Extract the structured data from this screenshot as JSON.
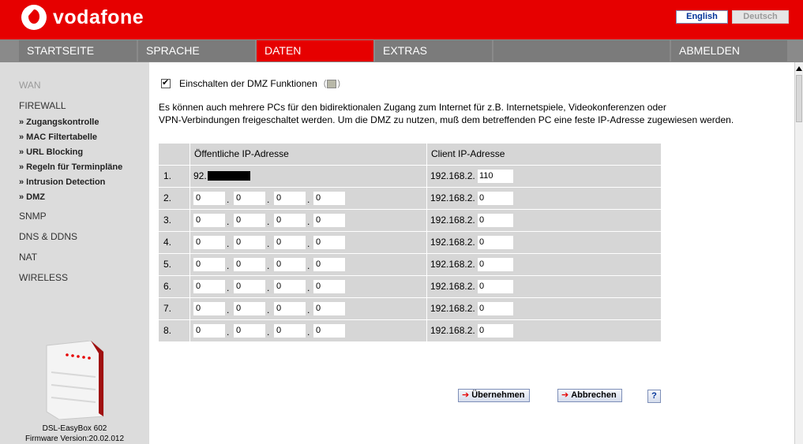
{
  "header": {
    "brand": "vodafone",
    "lang_english": "English",
    "lang_deutsch": "Deutsch"
  },
  "nav": [
    {
      "label": "STARTSEITE"
    },
    {
      "label": "SPRACHE"
    },
    {
      "label": "DATEN"
    },
    {
      "label": "EXTRAS"
    },
    {
      "label": ""
    },
    {
      "label": "ABMELDEN"
    }
  ],
  "sidebar": {
    "wan": "WAN",
    "firewall": "FIREWALL",
    "sub": [
      "» Zugangskontrolle",
      "» MAC Filtertabelle",
      "» URL Blocking",
      "» Regeln für Terminpläne",
      "» Intrusion Detection",
      "» DMZ"
    ],
    "snmp": "SNMP",
    "dns": "DNS & DDNS",
    "nat": "NAT",
    "wireless": "WIRELESS",
    "device_name": "DSL-EasyBox 602",
    "firmware": "Firmware Version:20.02.012"
  },
  "main": {
    "dmz_label": "Einschalten der DMZ Funktionen",
    "description_line1": "Es können auch mehrere PCs für den bidirektionalen Zugang zum Internet für z.B. Internetspiele, Videokonferenzen oder",
    "description_line2": "VPN-Verbindungen freigeschaltet werden. Um die DMZ zu nutzen, muß dem betreffenden PC eine feste IP-Adresse zugewiesen werden.",
    "col_public": "Öffentliche IP-Adresse",
    "col_client": "Client IP-Adresse",
    "first_public_prefix": "92.",
    "client_prefix": "192.168.2.",
    "rows": [
      {
        "num": "1.",
        "o1": "",
        "o2": "",
        "o3": "",
        "o4": "",
        "host": "110"
      },
      {
        "num": "2.",
        "o1": "0",
        "o2": "0",
        "o3": "0",
        "o4": "0",
        "host": "0"
      },
      {
        "num": "3.",
        "o1": "0",
        "o2": "0",
        "o3": "0",
        "o4": "0",
        "host": "0"
      },
      {
        "num": "4.",
        "o1": "0",
        "o2": "0",
        "o3": "0",
        "o4": "0",
        "host": "0"
      },
      {
        "num": "5.",
        "o1": "0",
        "o2": "0",
        "o3": "0",
        "o4": "0",
        "host": "0"
      },
      {
        "num": "6.",
        "o1": "0",
        "o2": "0",
        "o3": "0",
        "o4": "0",
        "host": "0"
      },
      {
        "num": "7.",
        "o1": "0",
        "o2": "0",
        "o3": "0",
        "o4": "0",
        "host": "0"
      },
      {
        "num": "8.",
        "o1": "0",
        "o2": "0",
        "o3": "0",
        "o4": "0",
        "host": "0"
      }
    ],
    "apply": "Übernehmen",
    "cancel": "Abbrechen",
    "help": "?"
  },
  "colors": {
    "brand_red": "#e60000",
    "nav_gray": "#7b7b7b",
    "sidebar_bg": "#dcdcdc",
    "table_bg": "#d6d6d6"
  }
}
